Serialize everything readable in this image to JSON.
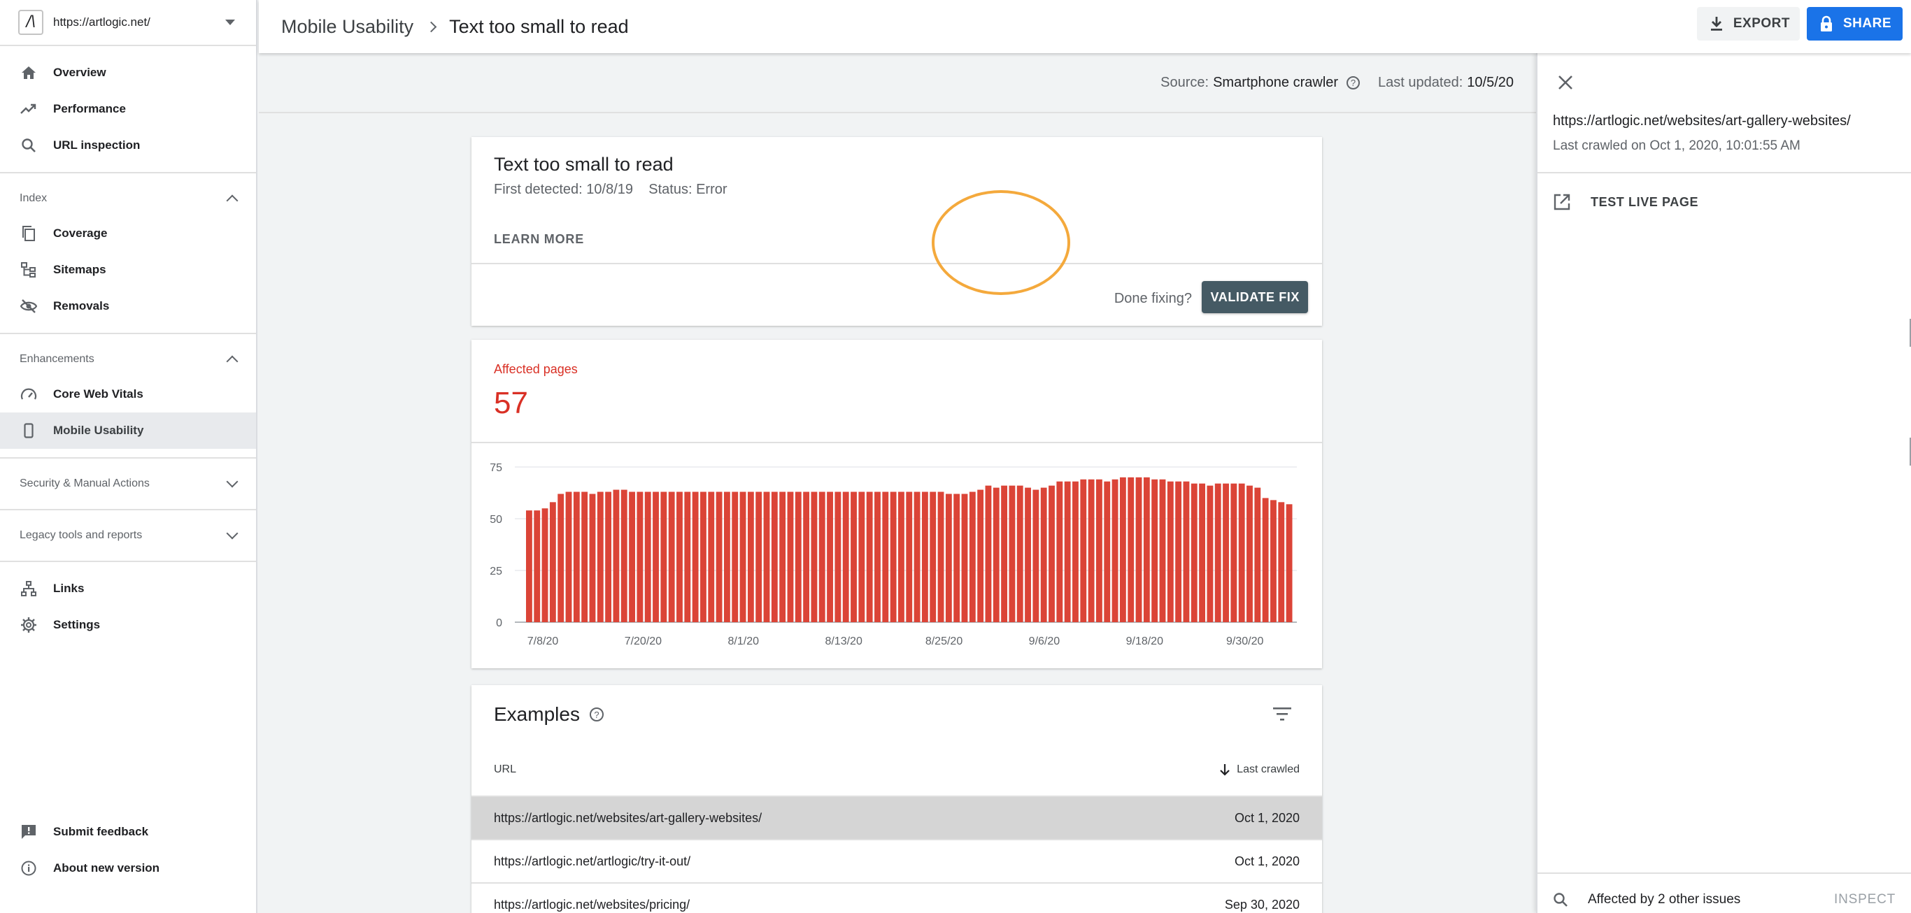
{
  "sidebar": {
    "property_url": "https://artlogic.net/",
    "top_items": [
      {
        "label": "Overview",
        "icon": "home-icon"
      },
      {
        "label": "Performance",
        "icon": "trending-up-icon"
      },
      {
        "label": "URL inspection",
        "icon": "search-icon"
      }
    ],
    "index": {
      "heading": "Index",
      "items": [
        {
          "label": "Coverage",
          "icon": "pages-icon"
        },
        {
          "label": "Sitemaps",
          "icon": "sitemap-icon"
        },
        {
          "label": "Removals",
          "icon": "eye-off-icon"
        }
      ]
    },
    "enhancements": {
      "heading": "Enhancements",
      "items": [
        {
          "label": "Core Web Vitals",
          "icon": "gauge-icon"
        },
        {
          "label": "Mobile Usability",
          "icon": "phone-icon",
          "active": true
        }
      ]
    },
    "security_heading": "Security & Manual Actions",
    "legacy_heading": "Legacy tools and reports",
    "links_label": "Links",
    "settings_label": "Settings",
    "feedback_label": "Submit feedback",
    "about_label": "About new version"
  },
  "header": {
    "crumb_parent": "Mobile Usability",
    "crumb_current": "Text too small to read",
    "export_label": "EXPORT",
    "share_label": "SHARE"
  },
  "source_bar": {
    "source_prefix": "Source:",
    "source_value": "Smartphone crawler",
    "updated_prefix": "Last updated:",
    "updated_value": "10/5/20"
  },
  "issue_card": {
    "title": "Text too small to read",
    "first_detected": "First detected: 10/8/19",
    "status": "Status: Error",
    "learn_more": "LEARN MORE",
    "done_fixing": "Done fixing?",
    "validate_label": "VALIDATE FIX"
  },
  "affected": {
    "label": "Affected pages",
    "value": "57"
  },
  "chart_data": {
    "type": "bar",
    "series_color": "#db4437",
    "ylim": [
      0,
      75
    ],
    "yticks": [
      0,
      25,
      50,
      75
    ],
    "xtick_labels": [
      "7/8/20",
      "7/20/20",
      "8/1/20",
      "8/13/20",
      "8/25/20",
      "9/6/20",
      "9/18/20",
      "9/30/20"
    ],
    "grid": true,
    "values": [
      54,
      54,
      55,
      58,
      62,
      63,
      63,
      63,
      62,
      63,
      63,
      64,
      64,
      63,
      63,
      63,
      63,
      63,
      63,
      63,
      63,
      63,
      63,
      63,
      63,
      63,
      63,
      63,
      63,
      63,
      63,
      63,
      63,
      63,
      63,
      63,
      63,
      63,
      63,
      63,
      63,
      63,
      63,
      63,
      63,
      63,
      63,
      63,
      63,
      63,
      63,
      63,
      63,
      62,
      62,
      62,
      63,
      64,
      66,
      65,
      66,
      66,
      66,
      65,
      64,
      65,
      66,
      68,
      68,
      68,
      69,
      69,
      69,
      68,
      69,
      70,
      70,
      70,
      70,
      69,
      69,
      68,
      68,
      68,
      67,
      67,
      66,
      67,
      67,
      67,
      67,
      66,
      65,
      60,
      59,
      58,
      57
    ]
  },
  "examples": {
    "title": "Examples",
    "col_url": "URL",
    "col_crawled": "Last crawled",
    "rows": [
      {
        "url": "https://artlogic.net/websites/art-gallery-websites/",
        "date": "Oct 1, 2020",
        "selected": true
      },
      {
        "url": "https://artlogic.net/artlogic/try-it-out/",
        "date": "Oct 1, 2020"
      },
      {
        "url": "https://artlogic.net/websites/pricing/",
        "date": "Sep 30, 2020"
      }
    ]
  },
  "detail_panel": {
    "url": "https://artlogic.net/websites/art-gallery-websites/",
    "last_crawled": "Last crawled on Oct 1, 2020, 10:01:55 AM",
    "test_live": "TEST LIVE PAGE",
    "affected_other": "Affected by 2 other issues",
    "inspect": "INSPECT"
  }
}
